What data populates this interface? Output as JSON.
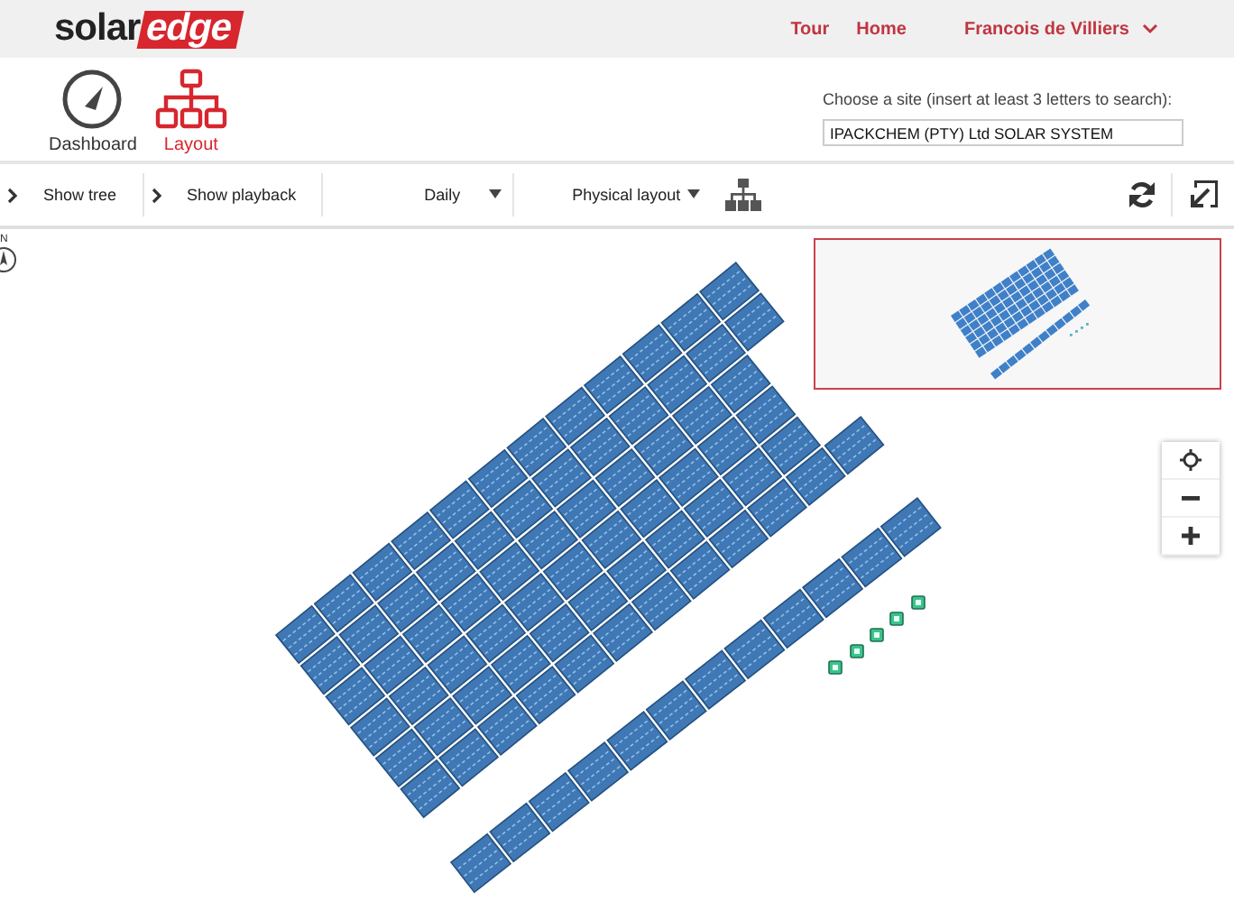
{
  "header": {
    "logo": {
      "part_1": "solar",
      "part_2": "edge"
    },
    "nav_links": [
      {
        "label": "Tour"
      },
      {
        "label": "Home"
      }
    ],
    "user_menu": {
      "label": "Francois de Villiers"
    }
  },
  "views": [
    {
      "label": "Dashboard",
      "kind": "gauge",
      "selected": false
    },
    {
      "label": "Layout",
      "kind": "hierarchy",
      "selected": true
    }
  ],
  "site_search": {
    "label": "Choose a site (insert at least 3 letters to search):",
    "value": "IPACKCHEM (PTY) Ltd SOLAR SYSTEM"
  },
  "toolbar": {
    "toggles": [
      {
        "label": "Show tree"
      },
      {
        "label": "Show playback"
      }
    ],
    "dropdowns": [
      {
        "label": "Daily"
      },
      {
        "label": "Physical layout"
      }
    ]
  },
  "canvas": {
    "compass": {
      "label": "N"
    }
  }
}
